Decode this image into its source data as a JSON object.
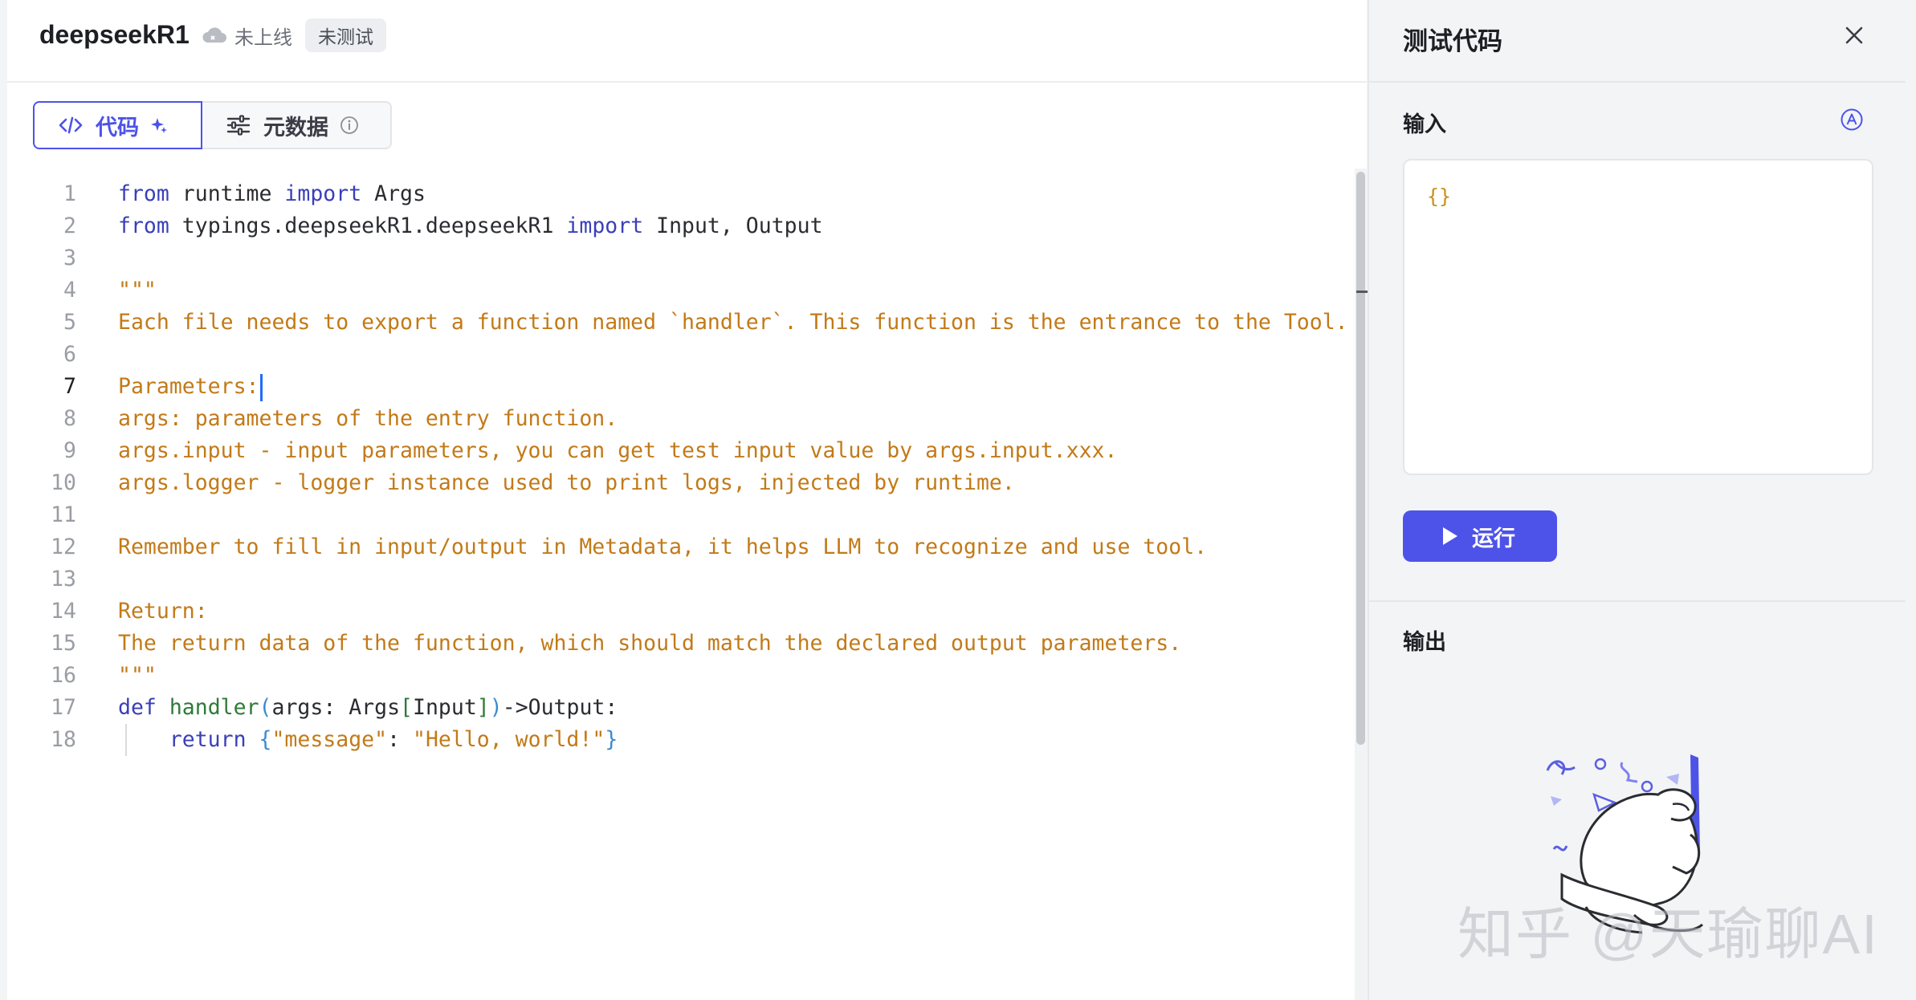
{
  "header": {
    "tool_name": "deepseekR1",
    "status_text": "未上线",
    "test_badge": "未测试",
    "cloud_icon": "cloud-icon"
  },
  "tabs": [
    {
      "label": "代码",
      "icon": "code-icon",
      "active": true
    },
    {
      "label": "元数据",
      "icon": "sliders-icon",
      "active": false
    }
  ],
  "editor": {
    "active_line": 7,
    "lines": [
      {
        "num": "1",
        "parts": [
          {
            "t": "from",
            "c": "kw"
          },
          {
            "t": " runtime ",
            "c": "id"
          },
          {
            "t": "import",
            "c": "kw"
          },
          {
            "t": " Args",
            "c": "id"
          }
        ]
      },
      {
        "num": "2",
        "parts": [
          {
            "t": "from",
            "c": "kw"
          },
          {
            "t": " typings.deepseekR1.deepseekR1 ",
            "c": "id"
          },
          {
            "t": "import",
            "c": "kw"
          },
          {
            "t": " Input, Output",
            "c": "id"
          }
        ]
      },
      {
        "num": "3",
        "parts": []
      },
      {
        "num": "4",
        "parts": [
          {
            "t": "\"\"\"",
            "c": "str"
          }
        ]
      },
      {
        "num": "5",
        "parts": [
          {
            "t": "Each file needs to export a function named `handler`. This function is the entrance to the Tool.",
            "c": "str"
          }
        ]
      },
      {
        "num": "6",
        "parts": []
      },
      {
        "num": "7",
        "parts": [
          {
            "t": "Parameters:",
            "c": "str"
          }
        ]
      },
      {
        "num": "8",
        "parts": [
          {
            "t": "args: parameters of the entry function.",
            "c": "str"
          }
        ]
      },
      {
        "num": "9",
        "parts": [
          {
            "t": "args.input - input parameters, you can get test input value by args.input.xxx.",
            "c": "str"
          }
        ]
      },
      {
        "num": "10",
        "parts": [
          {
            "t": "args.logger - logger instance used to print logs, injected by runtime.",
            "c": "str"
          }
        ]
      },
      {
        "num": "11",
        "parts": []
      },
      {
        "num": "12",
        "parts": [
          {
            "t": "Remember to fill in input/output in Metadata, it helps LLM to recognize and use tool.",
            "c": "str"
          }
        ]
      },
      {
        "num": "13",
        "parts": []
      },
      {
        "num": "14",
        "parts": [
          {
            "t": "Return:",
            "c": "str"
          }
        ]
      },
      {
        "num": "15",
        "parts": [
          {
            "t": "The return data of the function, which should match the declared output parameters.",
            "c": "str"
          }
        ]
      },
      {
        "num": "16",
        "parts": [
          {
            "t": "\"\"\"",
            "c": "str"
          }
        ]
      },
      {
        "num": "17",
        "parts": [
          {
            "t": "def",
            "c": "kw"
          },
          {
            "t": " ",
            "c": "id"
          },
          {
            "t": "handler",
            "c": "fn"
          },
          {
            "t": "(",
            "c": "br"
          },
          {
            "t": "args: Args",
            "c": "id"
          },
          {
            "t": "[",
            "c": "fn"
          },
          {
            "t": "Input",
            "c": "id"
          },
          {
            "t": "]",
            "c": "fn"
          },
          {
            "t": ")",
            "c": "br"
          },
          {
            "t": "->Output:",
            "c": "id"
          }
        ]
      },
      {
        "num": "18",
        "parts": [
          {
            "t": "    return ",
            "c": "kw"
          },
          {
            "t": "{",
            "c": "br"
          },
          {
            "t": "\"message\"",
            "c": "str"
          },
          {
            "t": ": ",
            "c": "id"
          },
          {
            "t": "\"Hello, world!\"",
            "c": "str"
          },
          {
            "t": "}",
            "c": "br"
          }
        ]
      }
    ]
  },
  "test_panel": {
    "title": "测试代码",
    "close_icon": "close-icon",
    "input_label": "输入",
    "ai_icon": "ai-assist-icon",
    "input_value": "{}",
    "run_label": "运行",
    "output_label": "输出",
    "illustration": "empty-state-illustration"
  },
  "watermark": "知乎 @天瑜聊AI",
  "colors": {
    "accent": "#4d53e8",
    "string": "#c27a18",
    "keyword": "#3b3fb8",
    "function": "#2f7a3a",
    "bracket": "#3b8bd0"
  }
}
